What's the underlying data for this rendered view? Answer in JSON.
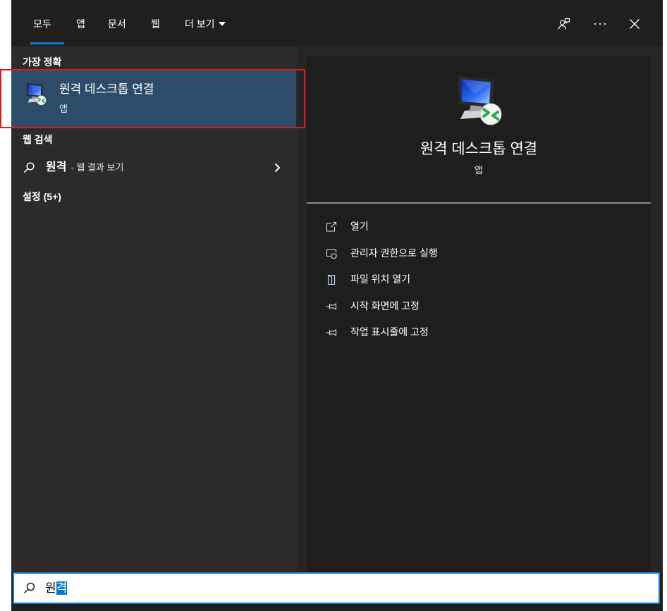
{
  "tabs": [
    {
      "label": "모두",
      "active": true
    },
    {
      "label": "앱",
      "active": false
    },
    {
      "label": "문서",
      "active": false
    },
    {
      "label": "웹",
      "active": false
    },
    {
      "label": "더 보기",
      "active": false
    }
  ],
  "toolbar_icons": [
    "feedback-icon",
    "more-icon",
    "close-icon"
  ],
  "results": {
    "best_match": {
      "heading": "가장 정확",
      "title": "원격 데스크톱 연결",
      "type": "앱",
      "icon": "remote-desktop-icon"
    },
    "web_search": {
      "heading": "웹 검색",
      "query": "원격",
      "suffix": "- 웹 결과 보기"
    },
    "settings": {
      "heading": "설정 (5+)"
    }
  },
  "preview": {
    "title": "원격 데스크톱 연결",
    "type": "앱",
    "icon": "remote-desktop-icon",
    "actions": [
      {
        "label": "열기",
        "icon": "open-icon"
      },
      {
        "label": "관리자 권한으로 실행",
        "icon": "run-as-admin-icon"
      },
      {
        "label": "파일 위치 열기",
        "icon": "file-location-icon"
      },
      {
        "label": "시작 화면에 고정",
        "icon": "pin-icon"
      },
      {
        "label": "작업 표시줄에 고정",
        "icon": "pin-icon"
      }
    ]
  },
  "search": {
    "typed_text": "원",
    "selected_text": "격"
  },
  "colors": {
    "accent": "#0078d7",
    "selection_bg": "#2c4c69",
    "annotation_red": "#e3191e",
    "left_pane_bg": "#2b2b2b",
    "preview_card_bg": "#1e1e1e"
  }
}
